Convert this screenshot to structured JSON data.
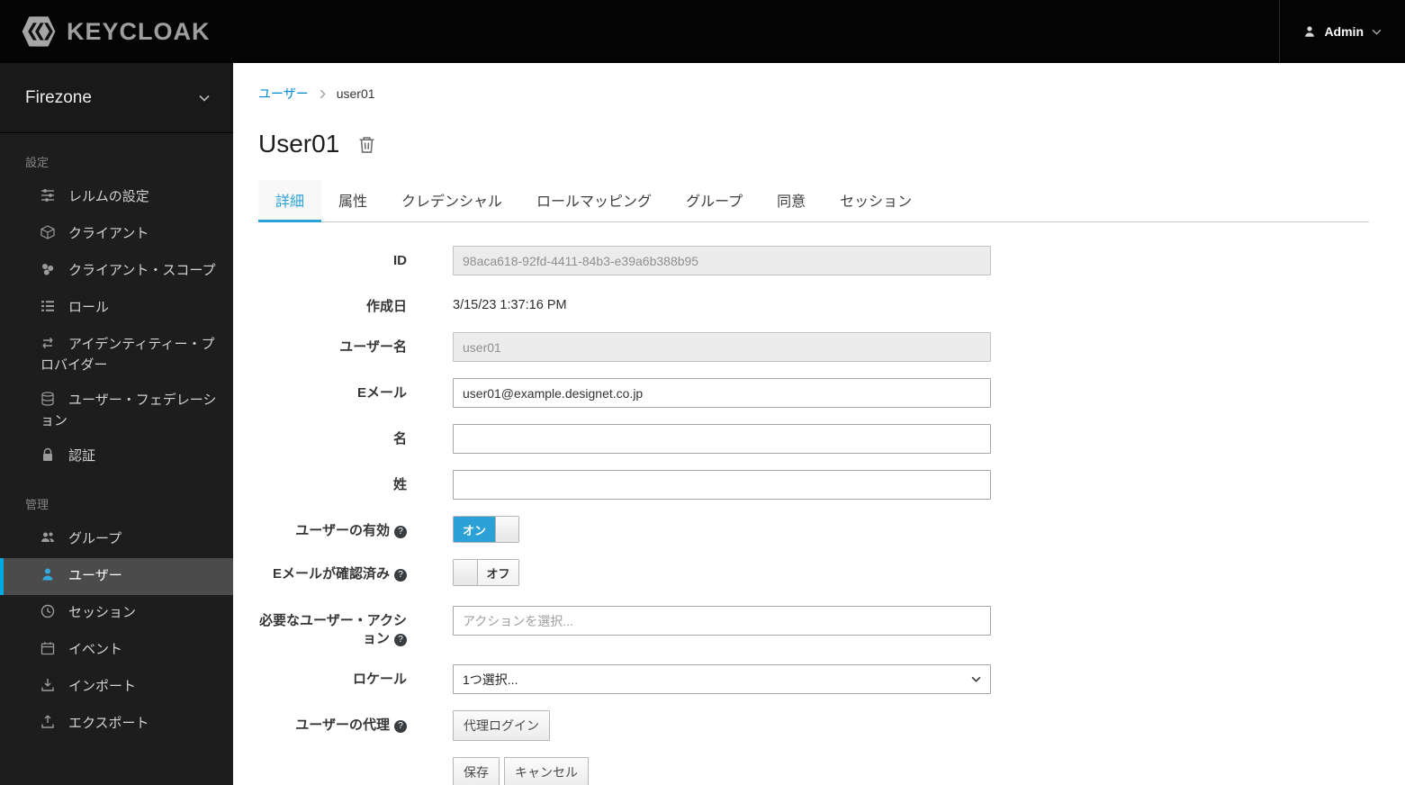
{
  "colors": {
    "link_blue": "#0088ce",
    "accent_blue": "#2aa2d8",
    "toggle_on_blue": "#2ba1d8",
    "topbar_bg": "#040404",
    "sidebar_bg": "#1d1d1d",
    "active_item_bg": "#4b4b4b"
  },
  "topbar": {
    "logo_text": "KEYCLOAK",
    "user_menu": {
      "label": "Admin"
    }
  },
  "sidebar": {
    "realm": "Firezone",
    "sections": [
      {
        "label": "設定",
        "items": [
          {
            "label": "レルムの設定",
            "icon": "sliders-icon"
          },
          {
            "label": "クライアント",
            "icon": "cube-icon"
          },
          {
            "label": "クライアント・スコープ",
            "icon": "client-scopes-icon"
          },
          {
            "label": "ロール",
            "icon": "roles-list-icon"
          },
          {
            "label": "アイデンティティー・プロバイダー",
            "icon": "arrows-exchange-icon"
          },
          {
            "label": "ユーザー・フェデレーション",
            "icon": "database-icon"
          },
          {
            "label": "認証",
            "icon": "lock-icon"
          }
        ]
      },
      {
        "label": "管理",
        "items": [
          {
            "label": "グループ",
            "icon": "groups-icon"
          },
          {
            "label": "ユーザー",
            "icon": "user-icon",
            "active": true
          },
          {
            "label": "セッション",
            "icon": "clock-icon"
          },
          {
            "label": "イベント",
            "icon": "calendar-icon"
          },
          {
            "label": "インポート",
            "icon": "import-icon"
          },
          {
            "label": "エクスポート",
            "icon": "export-icon"
          }
        ]
      }
    ]
  },
  "breadcrumb": {
    "link": "ユーザー",
    "current": "user01"
  },
  "page": {
    "title": "User01"
  },
  "tabs": [
    {
      "label": "詳細",
      "active": true
    },
    {
      "label": "属性"
    },
    {
      "label": "クレデンシャル"
    },
    {
      "label": "ロールマッピング"
    },
    {
      "label": "グループ"
    },
    {
      "label": "同意"
    },
    {
      "label": "セッション"
    }
  ],
  "form": {
    "id": {
      "label": "ID",
      "value": "98aca618-92fd-4411-84b3-e39a6b388b95"
    },
    "created": {
      "label": "作成日",
      "value": "3/15/23 1:37:16 PM"
    },
    "username": {
      "label": "ユーザー名",
      "value": "user01"
    },
    "email": {
      "label": "Eメール",
      "value": "user01@example.designet.co.jp"
    },
    "first_name": {
      "label": "名",
      "value": ""
    },
    "last_name": {
      "label": "姓",
      "value": ""
    },
    "user_enabled": {
      "label": "ユーザーの有効",
      "state": "オン"
    },
    "email_verified": {
      "label": "Eメールが確認済み",
      "state": "オフ"
    },
    "required_actions": {
      "label": "必要なユーザー・アクション",
      "placeholder": "アクションを選択..."
    },
    "locale": {
      "label": "ロケール",
      "value": "1つ選択..."
    },
    "impersonate": {
      "label": "ユーザーの代理",
      "button": "代理ログイン"
    },
    "actions": {
      "save": "保存",
      "cancel": "キャンセル"
    }
  }
}
